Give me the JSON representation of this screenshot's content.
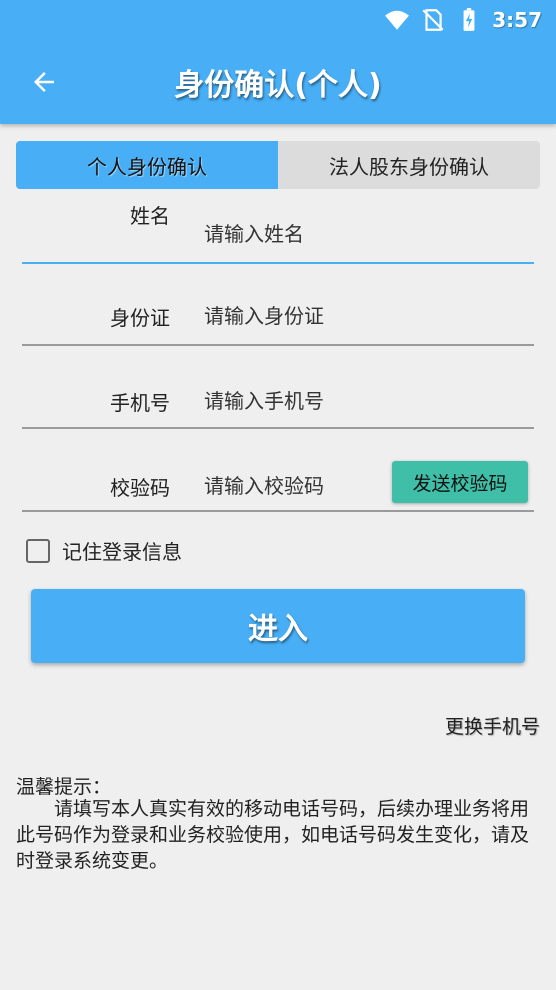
{
  "status_bar": {
    "time": "3:57"
  },
  "header": {
    "title": "身份确认(个人)"
  },
  "tabs": [
    {
      "label": "个人身份确认",
      "active": true
    },
    {
      "label": "法人股东身份确认",
      "active": false
    }
  ],
  "form": {
    "fields": [
      {
        "label": "姓名",
        "placeholder": "请输入姓名",
        "value": ""
      },
      {
        "label": "身份证",
        "placeholder": "请输入身份证",
        "value": ""
      },
      {
        "label": "手机号",
        "placeholder": "请输入手机号",
        "value": ""
      },
      {
        "label": "校验码",
        "placeholder": "请输入校验码",
        "value": ""
      }
    ],
    "send_code_label": "发送校验码",
    "remember_label": "记住登录信息",
    "remember_checked": false,
    "submit_label": "进入"
  },
  "change_phone_label": "更换手机号",
  "tip": {
    "title": "温馨提示：",
    "body": "请填写本人真实有效的移动电话号码，后续办理业务将用此号码作为登录和业务校验使用，如电话号码发生变化，请及时登录系统变更。"
  },
  "colors": {
    "primary": "#48aef5",
    "accent": "#3fbfa8",
    "background": "#efefef",
    "inactive_tab": "#dcdcdc"
  }
}
